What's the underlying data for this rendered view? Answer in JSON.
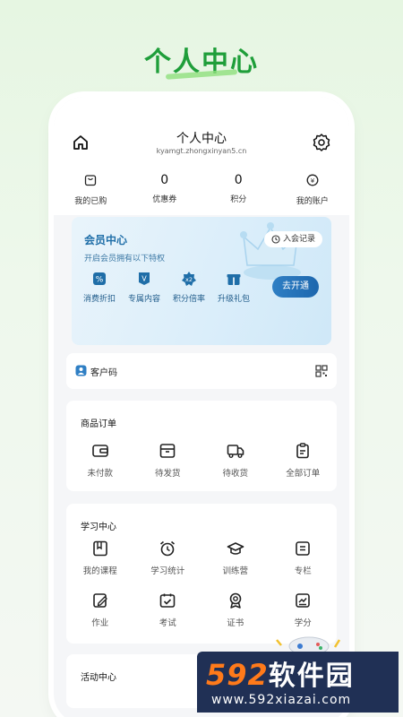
{
  "promo": {
    "title": "个人中心"
  },
  "navbar": {
    "title": "个人中心",
    "subtitle": "kyamgt.zhongxinyan5.cn",
    "home_icon": "home-icon",
    "settings_icon": "settings-icon"
  },
  "stats": [
    {
      "value": "",
      "label": "我的已购",
      "icon": "bag-icon"
    },
    {
      "value": "0",
      "label": "优惠券"
    },
    {
      "value": "0",
      "label": "积分"
    },
    {
      "value": "",
      "label": "我的账户",
      "icon": "wallet-icon"
    }
  ],
  "vip": {
    "title": "会员中心",
    "subtitle": "开启会员拥有以下特权",
    "record_label": "入会记录",
    "open_button": "去开通",
    "perks": [
      {
        "label": "消费折扣",
        "icon": "discount-icon"
      },
      {
        "label": "专属内容",
        "icon": "vip-v-icon"
      },
      {
        "label": "积分倍率",
        "icon": "x2-icon"
      },
      {
        "label": "升级礼包",
        "icon": "gift-icon"
      }
    ]
  },
  "customer_code": {
    "label": "客户码",
    "icon": "qr-code-icon"
  },
  "orders": {
    "title": "商品订单",
    "items": [
      {
        "label": "未付款",
        "icon": "wallet-icon"
      },
      {
        "label": "待发货",
        "icon": "box-icon"
      },
      {
        "label": "待收货",
        "icon": "truck-icon"
      },
      {
        "label": "全部订单",
        "icon": "clipboard-icon"
      }
    ]
  },
  "study": {
    "title": "学习中心",
    "items": [
      {
        "label": "我的课程",
        "icon": "book-icon"
      },
      {
        "label": "学习统计",
        "icon": "alarm-clock-icon"
      },
      {
        "label": "训练营",
        "icon": "graduation-cap-icon"
      },
      {
        "label": "专栏",
        "icon": "column-icon"
      },
      {
        "label": "作业",
        "icon": "edit-icon"
      },
      {
        "label": "考试",
        "icon": "calendar-check-icon"
      },
      {
        "label": "证书",
        "icon": "certificate-icon"
      },
      {
        "label": "学分",
        "icon": "chart-icon"
      }
    ]
  },
  "activity": {
    "title": "活动中心"
  },
  "watermark": {
    "brand_num": "592",
    "brand_cn": "软件园",
    "url": "www.592xiazai.com"
  },
  "colors": {
    "accent": "#1f9e3a",
    "vip_blue": "#1f6ea8",
    "button_blue": "#2f7fc4",
    "watermark_bg": "#203055"
  }
}
